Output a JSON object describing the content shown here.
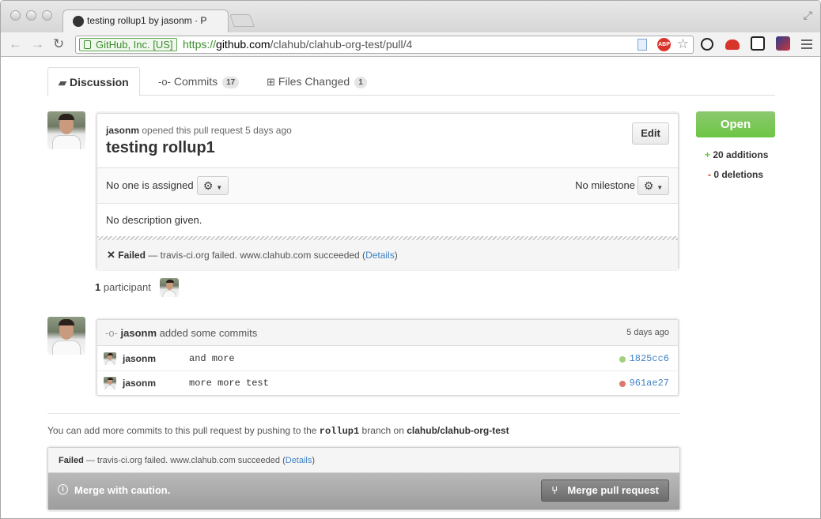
{
  "browser": {
    "tab_title": "testing rollup1 by jasonm · P",
    "ev_label": "GitHub, Inc. [US]",
    "url_scheme": "https://",
    "url_host": "github.com",
    "url_path": "/clahub/clahub-org-test/pull/4"
  },
  "tabs": [
    {
      "label": "Discussion",
      "icon": "comment-icon",
      "selected": true
    },
    {
      "label": "Commits",
      "icon": "commit-icon",
      "count": "17"
    },
    {
      "label": "Files Changed",
      "icon": "diff-icon",
      "count": "1"
    }
  ],
  "pull_request": {
    "author": "jasonm",
    "opened_text": "opened this pull request 5 days ago",
    "title": "testing rollup1",
    "edit_label": "Edit",
    "assignee_text": "No one is assigned",
    "milestone_text": "No milestone",
    "description": "No description given.",
    "status_label": "Failed",
    "status_text": "— travis-ci.org failed. www.clahub.com succeeded (",
    "details_label": "Details",
    "status_close": ")"
  },
  "participants": {
    "count": "1",
    "label": "participant"
  },
  "sidebar": {
    "state_label": "Open",
    "additions_sign": "+",
    "additions": "20 additions",
    "deletions_sign": "-",
    "deletions": "0 deletions"
  },
  "commits_event": {
    "author": "jasonm",
    "action": "added some commits",
    "time": "5 days ago",
    "commits": [
      {
        "author": "jasonm",
        "message": "and more",
        "sha": "1825cc6",
        "status_color": "#a0d07d"
      },
      {
        "author": "jasonm",
        "message": "more more test",
        "sha": "961ae27",
        "status_color": "#d97b6c"
      }
    ]
  },
  "push_hint": {
    "prefix": "You can add more commits to this pull request by pushing to the",
    "branch": "rollup1",
    "middle": "branch on",
    "repo": "clahub/clahub-org-test"
  },
  "merge": {
    "status_label": "Failed",
    "status_text": "— travis-ci.org failed. www.clahub.com succeeded (",
    "details_label": "Details",
    "status_close": ")",
    "caution_text": "Merge with caution.",
    "button_label": "Merge pull request"
  },
  "colors": {
    "open_green": "#6cc644",
    "link_blue": "#4183c4"
  }
}
